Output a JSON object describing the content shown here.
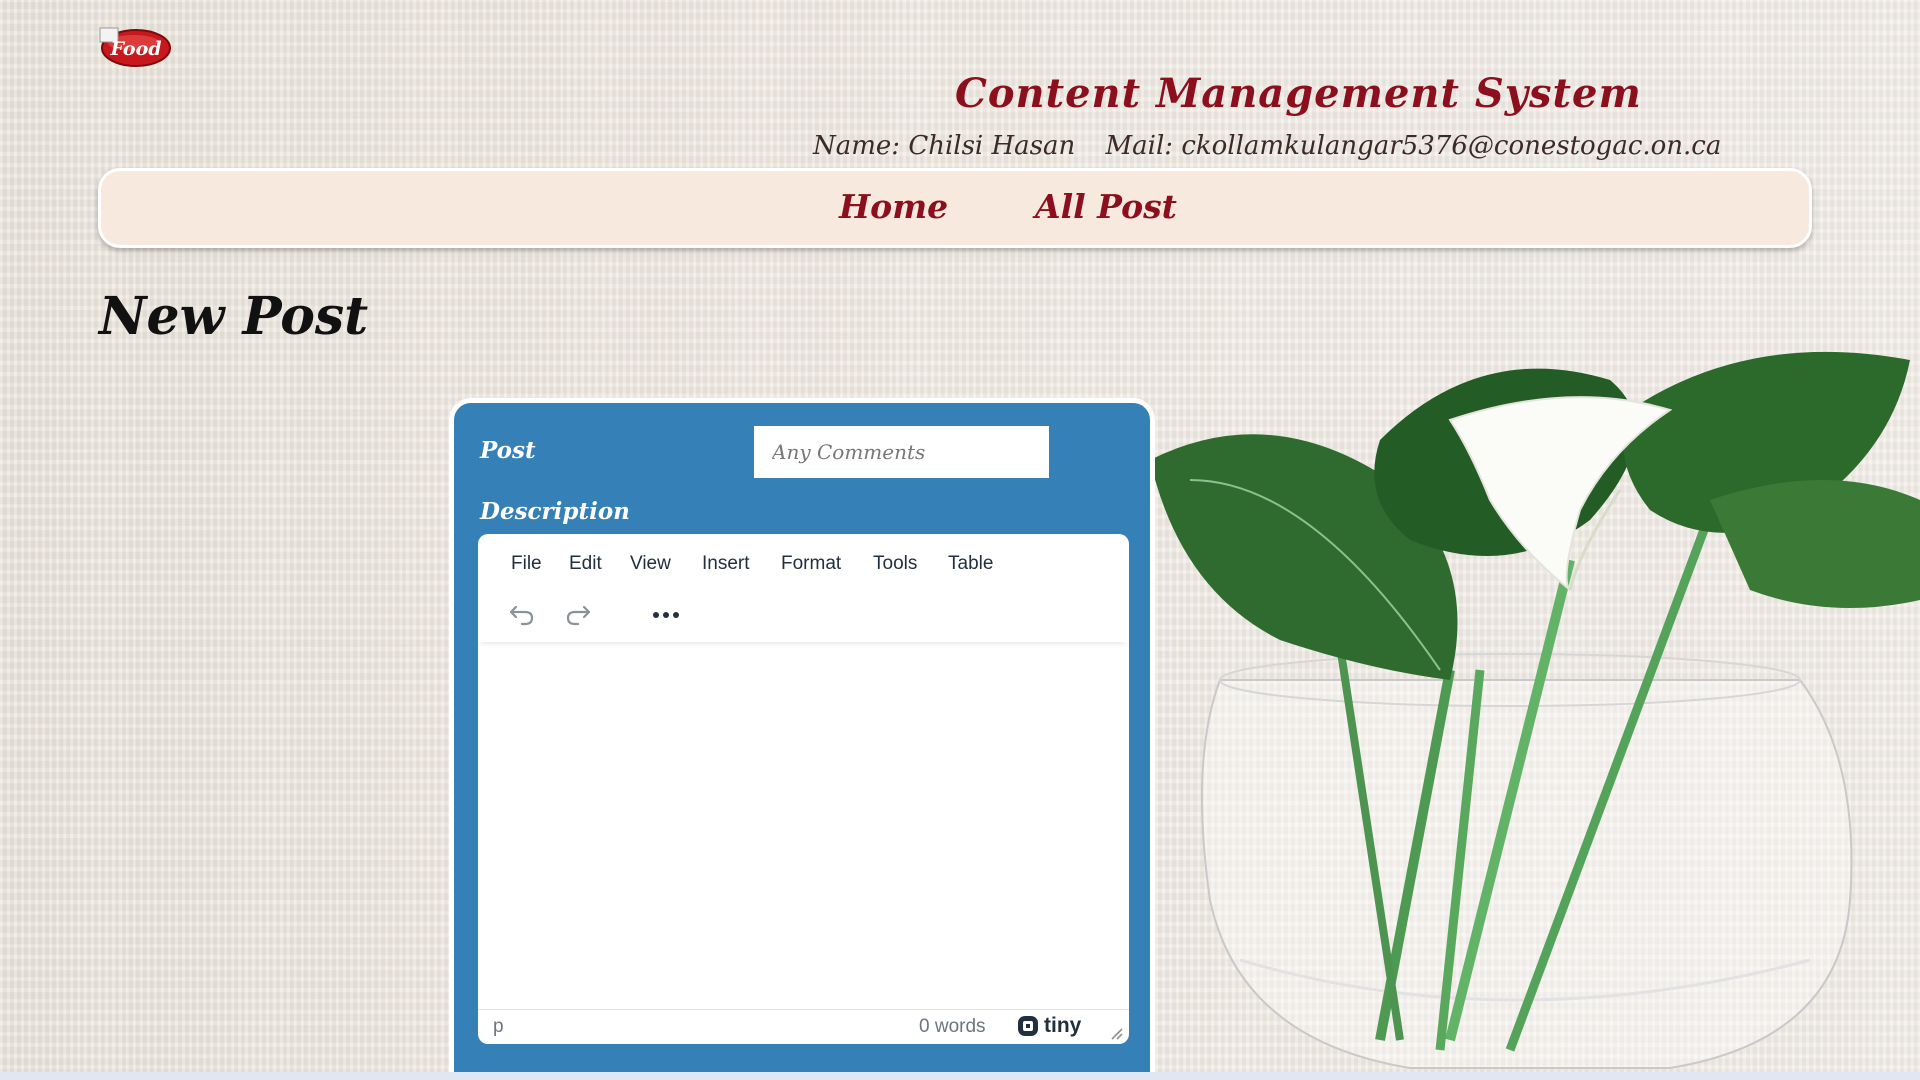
{
  "logo": {
    "text": "Food",
    "icon": "food-logo-icon"
  },
  "header": {
    "title": "Content Management System",
    "name": "Name: Chilsi Hasan",
    "mail": "Mail: ckollamkulangar5376@conestogac.on.ca"
  },
  "nav": {
    "home": "Home",
    "all_post": "All Post"
  },
  "page": {
    "heading": "New Post"
  },
  "form": {
    "post_label": "Post",
    "comments_placeholder": "Any Comments",
    "description_label": "Description"
  },
  "editor": {
    "menus": [
      "File",
      "Edit",
      "View",
      "Insert",
      "Format",
      "Tools",
      "Table"
    ],
    "toolbar": [
      "undo-icon",
      "redo-icon",
      "more-icon"
    ],
    "status_path": "p",
    "word_count": "0 words",
    "brand": "tiny"
  },
  "colors": {
    "accent": "#8b0f1c",
    "card": "#3580b6",
    "nav_bg": "#f7e9de"
  }
}
